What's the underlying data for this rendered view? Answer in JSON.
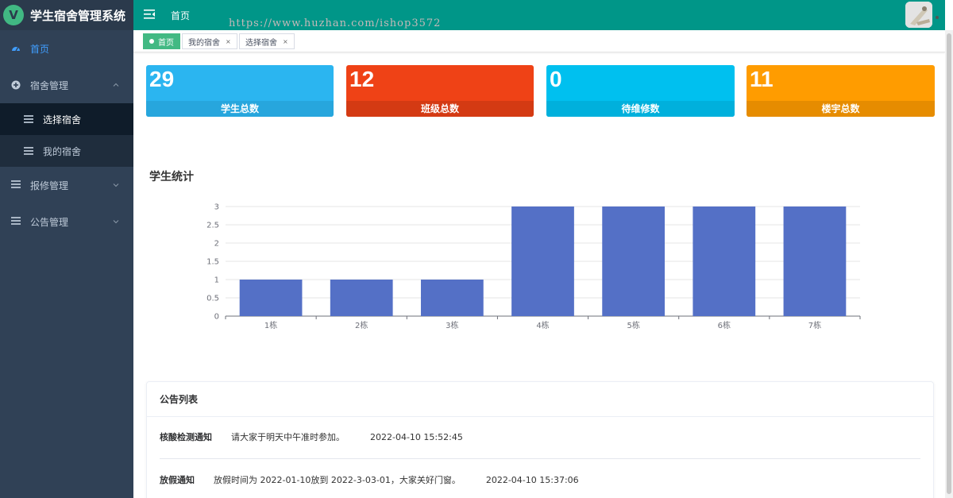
{
  "app": {
    "title": "学生宿舍管理系统",
    "logo_letter": "V"
  },
  "header": {
    "title": "首页",
    "watermark": "https://www.huzhan.com/ishop3572"
  },
  "sidebar": {
    "items": [
      {
        "label": "首页",
        "icon": "dashboard-icon",
        "active": true
      },
      {
        "label": "宿舍管理",
        "icon": "plus-circle-icon",
        "expanded": true,
        "children": [
          {
            "label": "选择宿舍"
          },
          {
            "label": "我的宿舍"
          }
        ]
      },
      {
        "label": "报修管理",
        "icon": "table-icon"
      },
      {
        "label": "公告管理",
        "icon": "table-icon"
      }
    ]
  },
  "tabs": [
    {
      "label": "首页",
      "active": true
    },
    {
      "label": "我的宿舍",
      "close": "×"
    },
    {
      "label": "选择宿舍",
      "close": "×"
    }
  ],
  "stats": [
    {
      "value": "29",
      "label": "学生总数",
      "color": "#2bb5f0",
      "band": "#27a6dd"
    },
    {
      "value": "12",
      "label": "班级总数",
      "color": "#ef4216",
      "band": "#d43a13"
    },
    {
      "value": "0",
      "label": "待维修数",
      "color": "#00c0ef",
      "band": "#00b0dc"
    },
    {
      "value": "11",
      "label": "楼宇总数",
      "color": "#ff9c00",
      "band": "#e68c00"
    }
  ],
  "chart_title": "学生统计",
  "chart_data": {
    "type": "bar",
    "categories": [
      "1栋",
      "2栋",
      "3栋",
      "4栋",
      "5栋",
      "6栋",
      "7栋"
    ],
    "values": [
      1,
      1,
      1,
      3,
      3,
      3,
      3
    ],
    "ylim": [
      0,
      3
    ],
    "yticks": [
      "0",
      "0.5",
      "1",
      "1.5",
      "2",
      "2.5",
      "3"
    ],
    "color": "#5470c6",
    "grid": true
  },
  "notice": {
    "title": "公告列表",
    "rows": [
      {
        "title": "核酸检测通知",
        "content": "请大家于明天中午准时参加。",
        "time": "2022-04-10 15:52:45"
      },
      {
        "title": "放假通知",
        "content": "放假时间为 2022-01-10放到 2022-3-03-01，大家关好门窗。",
        "time": "2022-04-10 15:37:06"
      }
    ]
  }
}
